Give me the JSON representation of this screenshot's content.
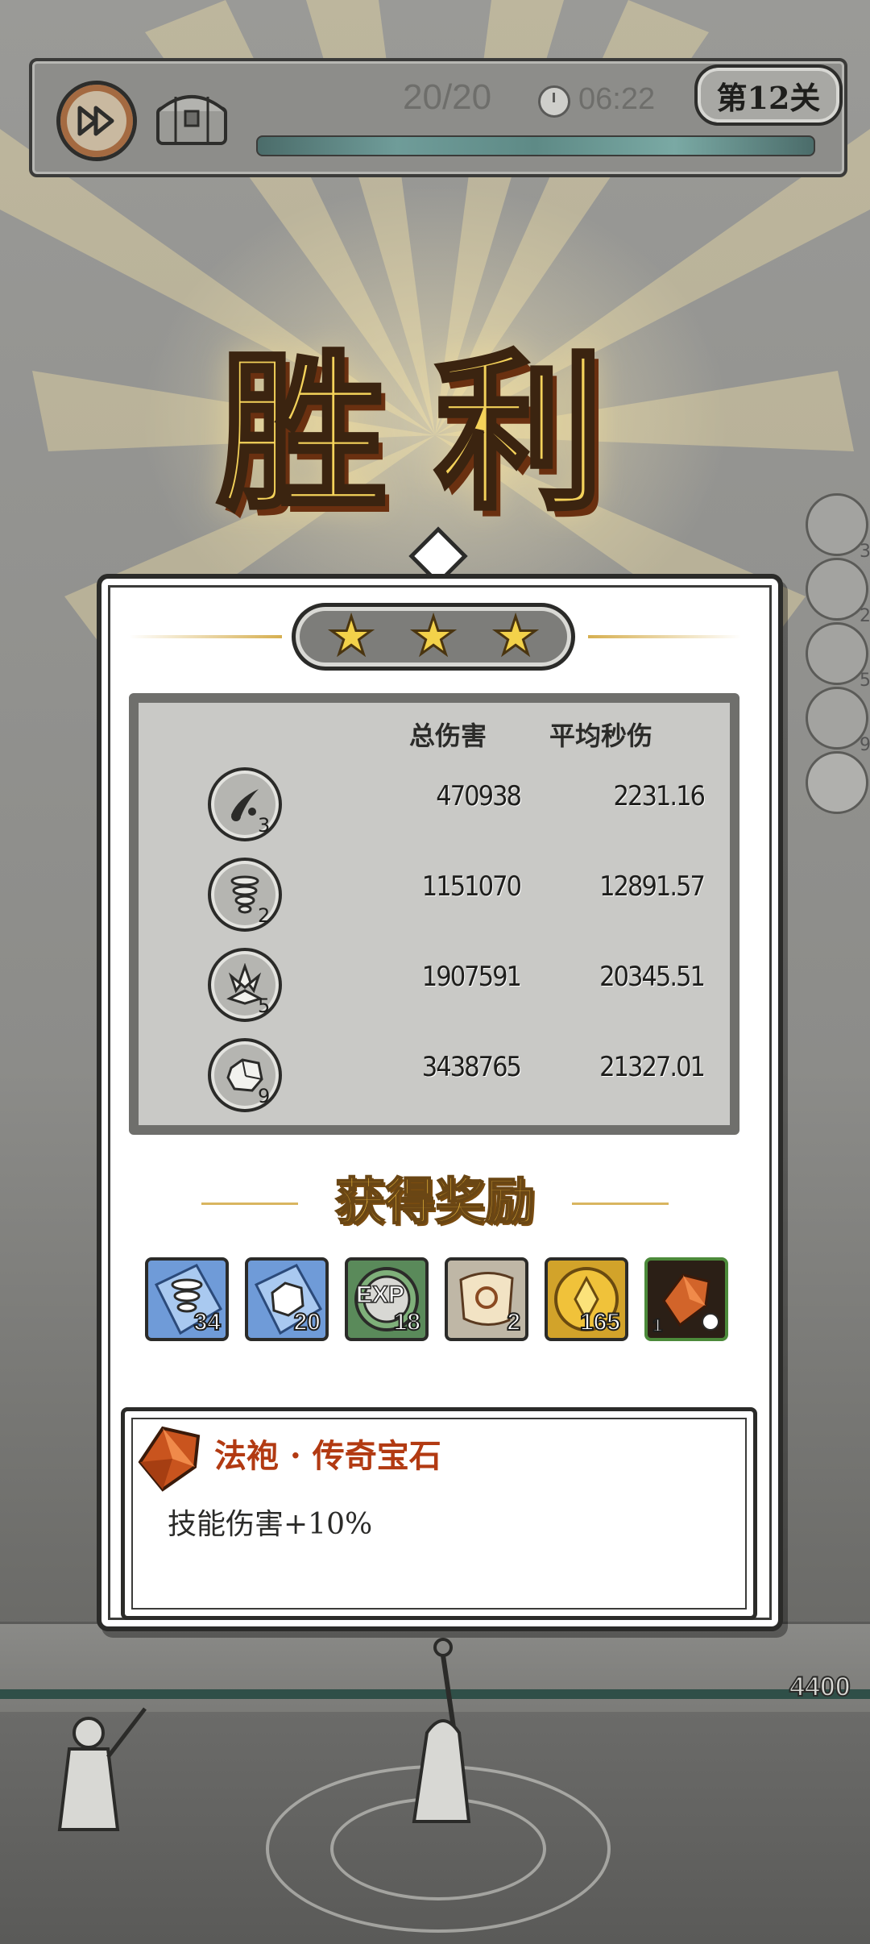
{
  "hud": {
    "wave": "20/20",
    "timer": "06:22",
    "stage": "第12关"
  },
  "victory_text": "胜利",
  "stars": 3,
  "stats": {
    "header_total": "总伤害",
    "header_dps": "平均秒伤",
    "rows": [
      {
        "skill_icon": "black-droplets-icon",
        "level": "3",
        "total": "470938",
        "dps": "2231.16"
      },
      {
        "skill_icon": "whirlwind-icon",
        "level": "2",
        "total": "1151070",
        "dps": "12891.57"
      },
      {
        "skill_icon": "crystal-shatter-icon",
        "level": "5",
        "total": "1907591",
        "dps": "20345.51"
      },
      {
        "skill_icon": "boulder-icon",
        "level": "9",
        "total": "3438765",
        "dps": "21327.01"
      }
    ]
  },
  "rewards": {
    "title": "获得奖励",
    "items": [
      {
        "icon": "whirlwind-shard-icon",
        "count": "34",
        "bg": "#6f9bd8"
      },
      {
        "icon": "boulder-shard-icon",
        "count": "20",
        "bg": "#6f9bd8"
      },
      {
        "icon": "exp-icon",
        "label": "EXP",
        "count": "18",
        "bg": "#5a8a5a"
      },
      {
        "icon": "scroll-icon",
        "count": "2",
        "bg": "#bfb7a6"
      },
      {
        "icon": "gold-coin-icon",
        "count": "165",
        "bg": "#d2a32a"
      },
      {
        "icon": "legendary-gem-icon",
        "count": "1",
        "bg": "#2b1f16"
      }
    ]
  },
  "gem": {
    "name": "法袍 · 传奇宝石",
    "effect": "技能伤害+10%"
  },
  "side_skill_levels": [
    "3",
    "2",
    "5",
    "9"
  ],
  "base_hp": "4400",
  "colors": {
    "gold": "#f4d25a",
    "accent_red": "#b23a12",
    "panel": "#ffffff"
  }
}
